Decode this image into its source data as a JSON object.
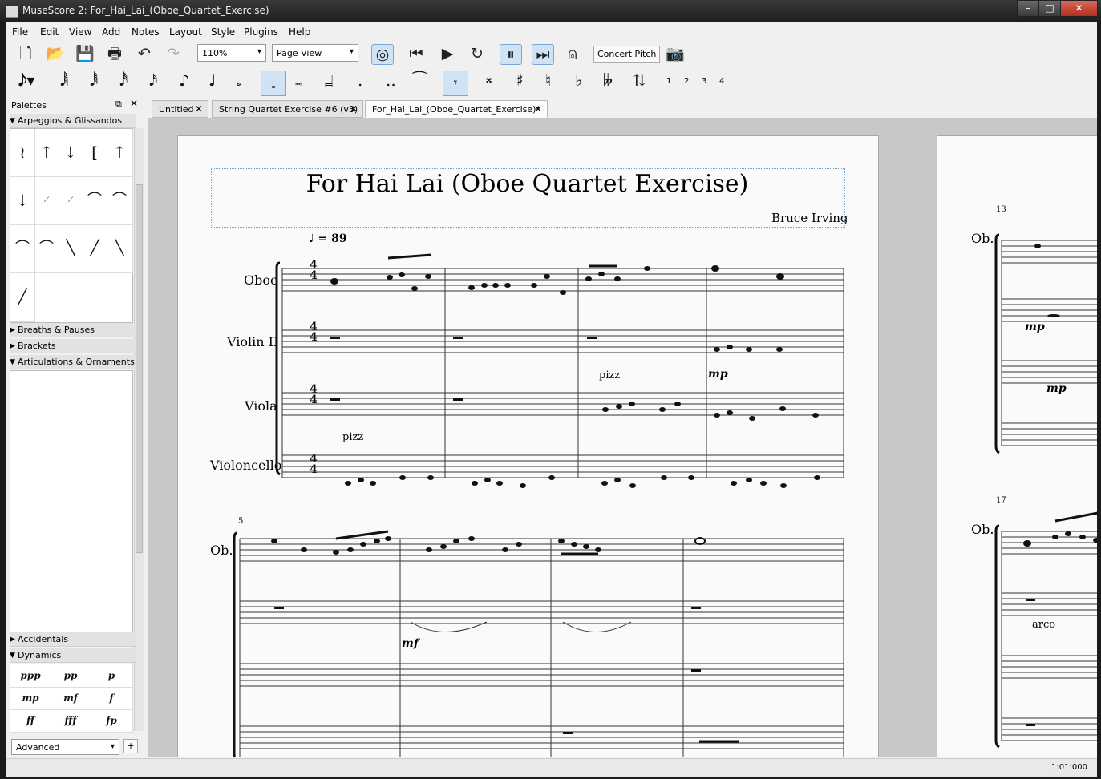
{
  "window": {
    "title": "MuseScore 2: For_Hai_Lai_(Oboe_Quartet_Exercise)"
  },
  "menu": [
    "File",
    "Edit",
    "View",
    "Add",
    "Notes",
    "Layout",
    "Style",
    "Plugins",
    "Help"
  ],
  "toolbar": {
    "zoom": "110%",
    "view_mode": "Page View",
    "concert_pitch": "Concert Pitch"
  },
  "note_input": {
    "voices": [
      "1",
      "2",
      "3",
      "4"
    ]
  },
  "palettes": {
    "title": "Palettes",
    "sections": {
      "arpeggios": "Arpeggios & Glissandos",
      "breaths": "Breaths & Pauses",
      "brackets": "Brackets",
      "articulations": "Articulations & Ornaments",
      "accidentals": "Accidentals",
      "dynamics": "Dynamics"
    },
    "workspace": "Advanced",
    "add_label": "+",
    "dynamics_items": [
      "ppp",
      "pp",
      "p",
      "mp",
      "mf",
      "f",
      "ff",
      "fff",
      "fp"
    ]
  },
  "tabs": [
    {
      "label": "Untitled"
    },
    {
      "label": "String Quartet Exercise #6 (v3)"
    },
    {
      "label": "For_Hai_Lai_(Oboe_Quartet_Exercise)*"
    }
  ],
  "score": {
    "title": "For Hai Lai (Oboe Quartet Exercise)",
    "composer": "Bruce Irving",
    "tempo": "= 89",
    "time_sig_num": "4",
    "time_sig_den": "4",
    "instruments": [
      "Oboe",
      "Violin II",
      "Viola",
      "Violoncello"
    ],
    "short_oboe": "Ob.",
    "pizz": "pizz",
    "arco": "arco",
    "mp": "mp",
    "mf": "mf",
    "measure_numbers": [
      "5",
      "13",
      "17"
    ]
  },
  "status": {
    "time": "1:01:000"
  }
}
